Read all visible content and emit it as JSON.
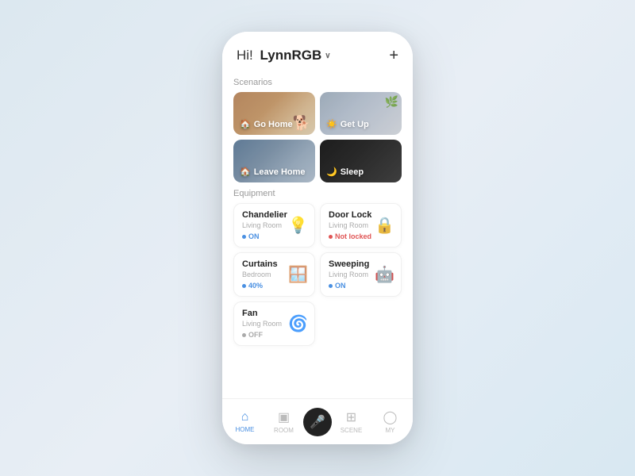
{
  "header": {
    "greeting": "Hi!",
    "username": "LynnRGB",
    "add_label": "+"
  },
  "scenarios": {
    "section_label": "Scenarios",
    "items": [
      {
        "id": "go-home",
        "label": "Go Home",
        "class": "go-home",
        "icon": "🏠"
      },
      {
        "id": "get-up",
        "label": "Get Up",
        "class": "get-up",
        "icon": "☀️"
      },
      {
        "id": "leave-home",
        "label": "Leave Home",
        "class": "leave-home",
        "icon": "🏠"
      },
      {
        "id": "sleep",
        "label": "Sleep",
        "class": "sleep",
        "icon": "🌙"
      }
    ]
  },
  "equipment": {
    "section_label": "Equipment",
    "items": [
      {
        "id": "chandelier",
        "name": "Chandelier",
        "room": "Living Room",
        "status": "ON",
        "status_type": "on",
        "icon": "💡"
      },
      {
        "id": "door-lock",
        "name": "Door Lock",
        "room": "Living Room",
        "status": "Not locked",
        "status_type": "locked",
        "icon": "🔒"
      },
      {
        "id": "curtains",
        "name": "Curtains",
        "room": "Bedroom",
        "status": "40%",
        "status_type": "on",
        "icon": "🪟"
      },
      {
        "id": "sweeping",
        "name": "Sweeping",
        "room": "Living Room",
        "status": "ON",
        "status_type": "on",
        "icon": "🤖"
      },
      {
        "id": "fan",
        "name": "Fan",
        "room": "Living Room",
        "status": "OFF",
        "status_type": "off",
        "icon": "🌀"
      }
    ]
  },
  "nav": {
    "items": [
      {
        "id": "home",
        "label": "HOME",
        "icon": "⌂",
        "active": true
      },
      {
        "id": "room",
        "label": "ROOM",
        "icon": "▣",
        "active": false
      },
      {
        "id": "mic",
        "label": "",
        "icon": "🎤",
        "is_mic": true
      },
      {
        "id": "scene",
        "label": "SCENE",
        "icon": "⊞",
        "active": false
      },
      {
        "id": "my",
        "label": "MY",
        "icon": "◯",
        "active": false
      }
    ]
  }
}
